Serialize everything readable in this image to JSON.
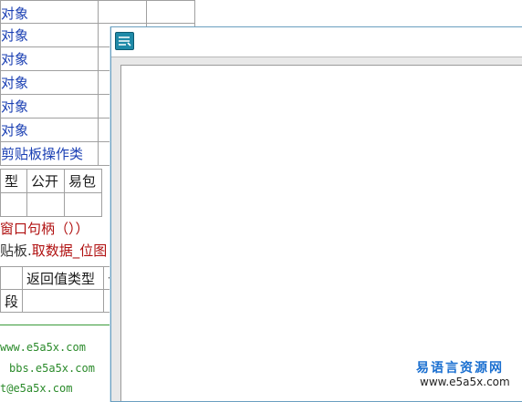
{
  "object_rows": [
    {
      "label": "对象"
    },
    {
      "label": "对象"
    },
    {
      "label": "对象"
    },
    {
      "label": "对象"
    },
    {
      "label": "对象"
    },
    {
      "label": "对象"
    },
    {
      "label": "剪贴板操作类"
    }
  ],
  "header": {
    "type_col": "型",
    "public_col": "公开",
    "easy_col": "易包"
  },
  "code": {
    "line1": "窗口句柄（））",
    "line2_prefix": "贴板.",
    "line2_call": "取数据_位图"
  },
  "return_table": {
    "col_return_type": "返回值类型",
    "col_public_partial": "公",
    "row_value": "段"
  },
  "comment_lines": {
    "line1": "www.e5a5x.com",
    "line2": "bbs.e5a5x.com",
    "line3": "t@e5a5x.com"
  },
  "watermark": {
    "brand": "易语言资源网",
    "url": "www.e5a5x.com"
  }
}
